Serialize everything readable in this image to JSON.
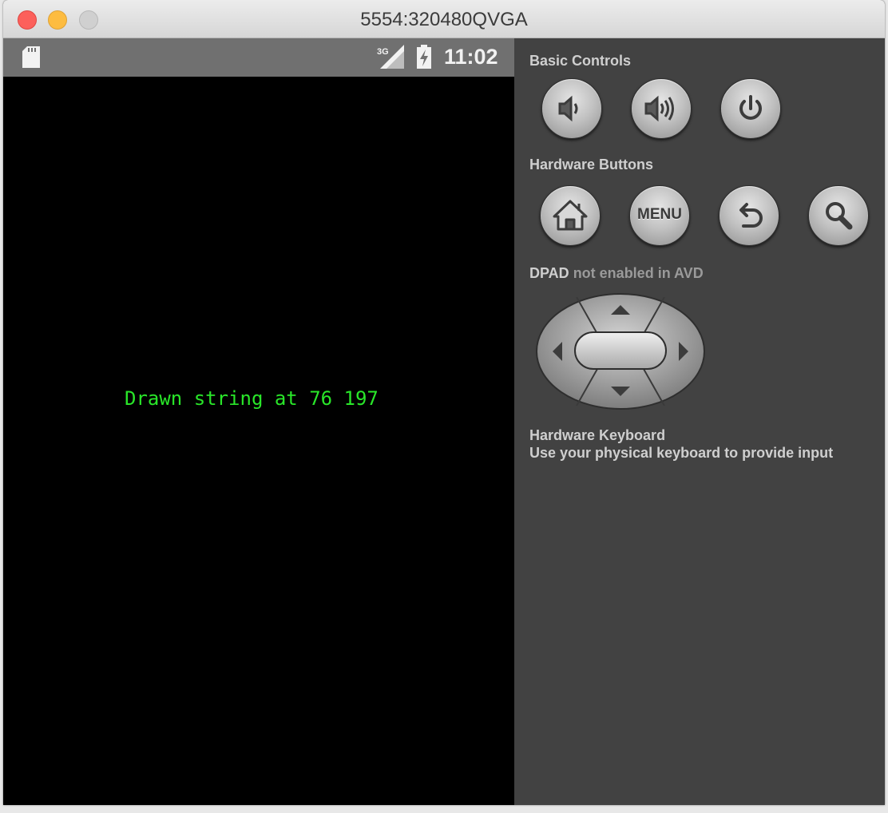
{
  "window": {
    "title": "5554:320480QVGA"
  },
  "statusbar": {
    "network": "3G",
    "time": "11:02"
  },
  "screen": {
    "drawn_text": "Drawn string at 76 197",
    "text_color": "#29e629"
  },
  "controls": {
    "basic_controls_label": "Basic Controls",
    "hardware_buttons_label": "Hardware Buttons",
    "menu_label": "MENU",
    "dpad_label": "DPAD",
    "dpad_note": "not enabled in AVD",
    "keyboard_title": "Hardware Keyboard",
    "keyboard_hint": "Use your physical keyboard to provide input"
  },
  "icons": {
    "basic": [
      "volume-down-icon",
      "volume-up-icon",
      "power-icon"
    ],
    "hardware": [
      "home-icon",
      "menu-icon",
      "back-icon",
      "search-icon"
    ]
  }
}
